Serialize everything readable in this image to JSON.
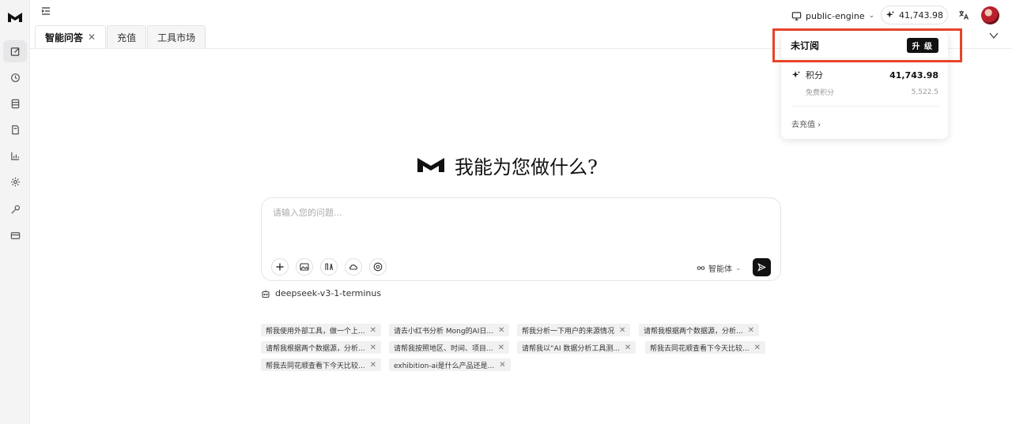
{
  "app": {
    "logo_icon": "m-logo-icon"
  },
  "sidebar": {
    "items": [
      {
        "name": "new-chat",
        "icon": "edit-icon",
        "active": true
      },
      {
        "name": "history",
        "icon": "history-icon"
      },
      {
        "name": "library",
        "icon": "library-icon"
      },
      {
        "name": "docs",
        "icon": "document-icon"
      },
      {
        "name": "analytics",
        "icon": "chart-icon"
      },
      {
        "name": "settings",
        "icon": "gear-icon"
      },
      {
        "name": "tools",
        "icon": "wrench-icon"
      },
      {
        "name": "billing",
        "icon": "card-icon"
      }
    ]
  },
  "tabs": [
    {
      "label": "智能问答",
      "active": true,
      "closable": true
    },
    {
      "label": "充值",
      "active": false,
      "closable": false
    },
    {
      "label": "工具市场",
      "active": false,
      "closable": false
    }
  ],
  "header": {
    "engine_label": "public-engine",
    "credits": "41,743.98"
  },
  "popover": {
    "title": "未订阅",
    "upgrade_label": "升 级",
    "points_label": "积分",
    "points_value": "41,743.98",
    "free_points_label": "免费积分",
    "free_points_value": "5,522.5",
    "recharge_label": "去充值 ›"
  },
  "hero": {
    "title": "我能为您做什么?"
  },
  "composer": {
    "placeholder": "请输入您的问题...",
    "agent_label": "智能体"
  },
  "model": {
    "name": "deepseek-v3-1-terminus"
  },
  "suggestions": [
    "帮我使用外部工具，做一个上...",
    "请去小红书分析 Mong的AI日...",
    "帮我分析一下用户的来源情况",
    "请帮我根据两个数据源，分析...",
    "请帮我根据两个数据源，分析...",
    "请帮我按照地区、时间、项目...",
    "请帮我以“AI 数据分析工具测...",
    "帮我去同花顺查看下今天比较...",
    "帮我去同花顺查看下今天比较...",
    "exhibition-ai是什么产品还是..."
  ],
  "colors": {
    "accent": "#111111",
    "highlight": "#e8432a",
    "sidebar_bg": "#f4f4f5"
  }
}
